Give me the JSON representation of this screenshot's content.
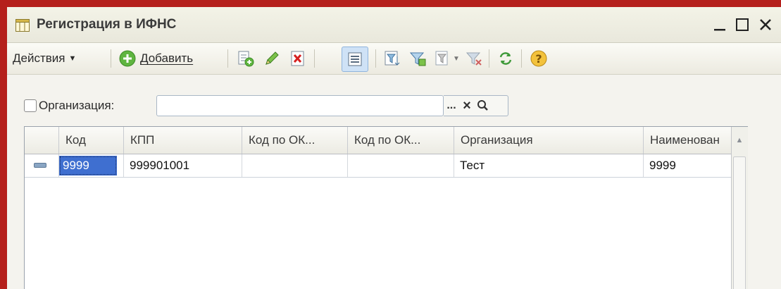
{
  "window": {
    "title": "Регистрация в ИФНС"
  },
  "toolbar": {
    "actions_label": "Действия",
    "add_label": "Добавить"
  },
  "filter": {
    "organization_label": "Организация:",
    "organization_value": "",
    "select_button": "...",
    "clear_button": "×",
    "checked": false
  },
  "table": {
    "columns": [
      "Код",
      "КПП",
      "Код по ОК...",
      "Код по ОК...",
      "Организация",
      "Наименован"
    ],
    "rows": [
      {
        "kod": "9999",
        "kpp": "999901001",
        "okato": "",
        "oktmo": "",
        "org": "Тест",
        "name": "9999"
      }
    ]
  },
  "colors": {
    "frame": "#b5201c",
    "selection": "#3f6fd0"
  }
}
